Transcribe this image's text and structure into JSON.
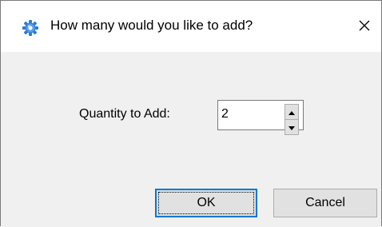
{
  "dialog": {
    "title": "How many would you like to add?",
    "app_icon": "gear-icon",
    "close_icon": "close-icon"
  },
  "form": {
    "quantity_label": "Quantity to Add:",
    "quantity_value": "2",
    "stepper_up_icon": "triangle-up-icon",
    "stepper_down_icon": "triangle-down-icon"
  },
  "buttons": {
    "ok_label": "OK",
    "cancel_label": "Cancel"
  },
  "colors": {
    "titlebar_bg": "#ffffff",
    "body_bg": "#f0f0f0",
    "button_bg": "#e1e1e1",
    "default_button_border": "#0078d7",
    "icon_blue": "#2f7ad6"
  }
}
